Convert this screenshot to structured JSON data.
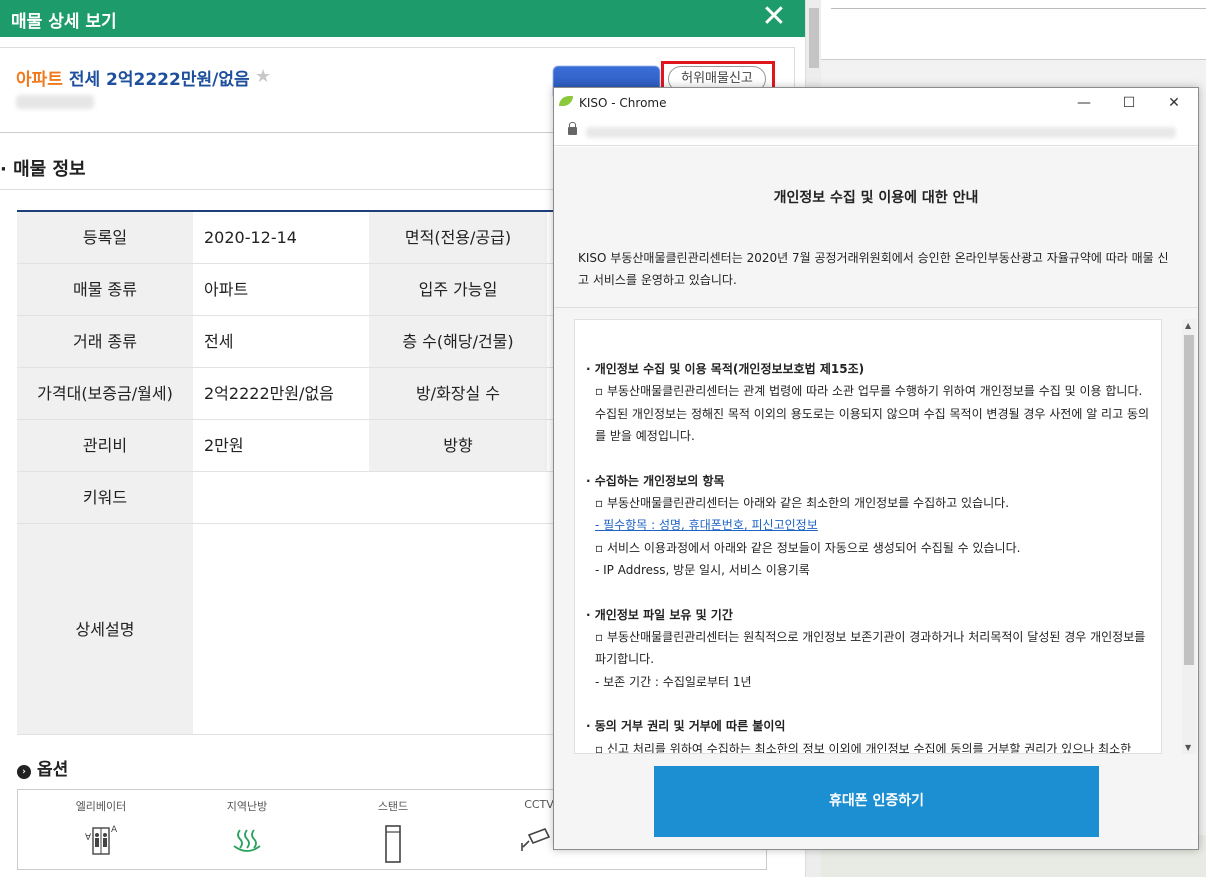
{
  "main": {
    "title": "매물 상세 보기",
    "close_glyph": "✕",
    "listing": {
      "type": "아파트",
      "price": "전세 2억2222만원/없음"
    },
    "report_button": "허위매물신고",
    "section_title": "· 매물 정보",
    "table": [
      {
        "label": "등록일",
        "value": "2020-12-14",
        "label2": "면적(전용/공급)"
      },
      {
        "label": "매물 종류",
        "value": "아파트",
        "label2": "입주 가능일"
      },
      {
        "label": "거래 종류",
        "value": "전세",
        "label2": "층 수(해당/건물)"
      },
      {
        "label": "가격대(보증금/월세)",
        "value": "2억2222만원/없음",
        "label2": "방/화장실 수"
      },
      {
        "label": "관리비",
        "value": "2만원",
        "label2": "방향"
      },
      {
        "label": "키워드",
        "value": "",
        "label2": ""
      },
      {
        "label": "상세설명",
        "value": "",
        "label2": ""
      }
    ],
    "options_title": "옵션",
    "options": [
      {
        "label": "엘리베이터",
        "icon": "elevator-icon"
      },
      {
        "label": "지역난방",
        "icon": "district-heating-icon"
      },
      {
        "label": "스탠드",
        "icon": "stand-icon"
      },
      {
        "label": "CCTV",
        "icon": "cctv-icon"
      }
    ]
  },
  "popup": {
    "window_title": "KISO - Chrome",
    "heading": "개인정보 수집 및 이용에 대한 안내",
    "intro": "KISO 부동산매물클린관리센터는 2020년 7월 공정거래위원회에서 승인한 온라인부동산광고 자율규약에 따라 매물 신고 서비스를 운영하고 있습니다.",
    "terms": {
      "s1_head": "· 개인정보 수집 및 이용 목적(개인정보보호법 제15조)",
      "s1_body": "▫ 부동산매물클린관리센터는 관계 법령에 따라 소관 업무를 수행하기 위하여 개인정보를 수집 및 이용 합니다. 수집된 개인정보는 정해진 목적 이외의 용도로는 이용되지 않으며 수집 목적이 변경될 경우 사전에 알 리고 동의를 받을 예정입니다.",
      "s2_head": "· 수집하는 개인정보의 항목",
      "s2_body": "▫ 부동산매물클린관리센터는 아래와 같은 최소한의 개인정보를 수집하고 있습니다.",
      "s2_required": "- 필수항목 : 성명, 휴대폰번호, 피신고인정보",
      "s2_auto": "▫ 서비스 이용과정에서 아래와 같은 정보들이 자동으로 생성되어 수집될 수 있습니다.",
      "s2_auto_items": "- IP Address, 방문 일시, 서비스 이용기록",
      "s3_head": "· 개인정보 파일 보유 및 기간",
      "s3_body": "▫ 부동산매물클린관리센터는 원칙적으로 개인정보 보존기관이 경과하거나 처리목적이 달성된 경우 개인정보를 파기합니다.",
      "s3_period": "- 보존 기간 : 수집일로부터 1년",
      "s4_head": "· 동의 거부 권리 및 거부에 따른 불이익",
      "s4_body": "▫ 신고 처리를 위하여 수집하는 최소한의 정보 이외에 개인정보 수집에 동의를 거부할 권리가 있으나 최소한"
    },
    "verify_button": "휴대폰 인증하기"
  }
}
